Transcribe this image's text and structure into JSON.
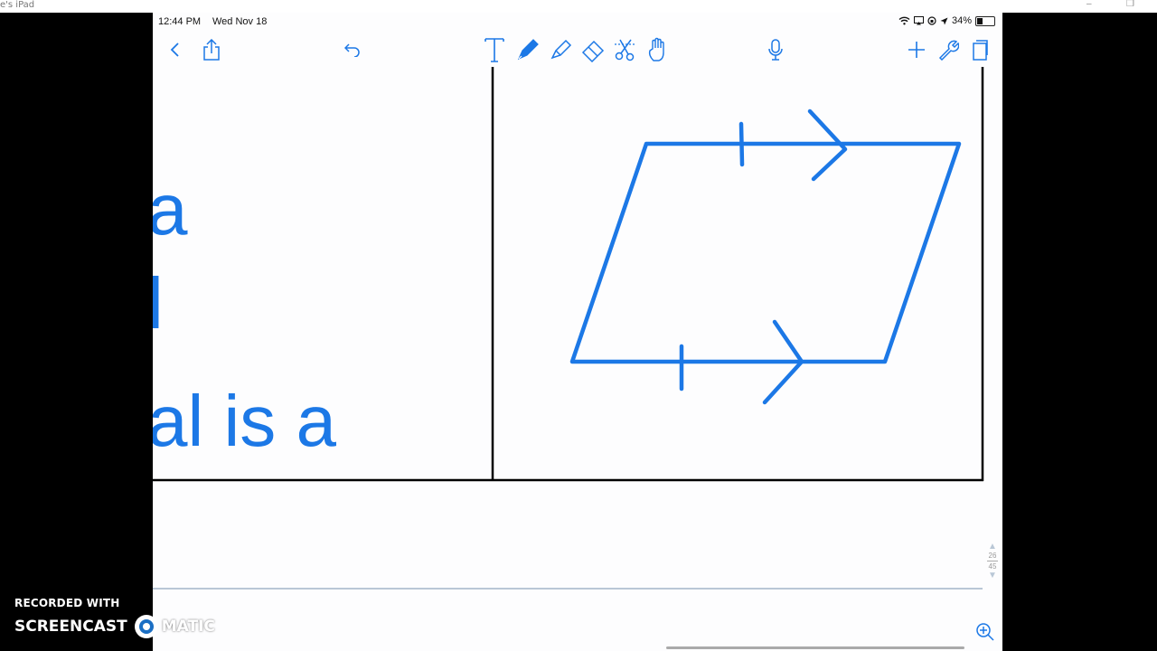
{
  "window": {
    "title": "e's iPad",
    "minimize_glyph": "–",
    "restore_glyph": "❐"
  },
  "status_bar": {
    "time": "12:44 PM",
    "date": "Wed Nov 18",
    "battery": "34%",
    "battery_level": 0.34,
    "icons": [
      "wifi-icon",
      "screen-mirroring-icon",
      "orientation-lock-icon",
      "location-icon"
    ]
  },
  "toolbar": {
    "left": [
      "back-icon",
      "share-icon",
      "undo-icon"
    ],
    "tools": [
      "text-tool-icon",
      "pen-tool-icon",
      "highlighter-tool-icon",
      "eraser-tool-icon",
      "lasso-tool-icon",
      "hand-tool-icon"
    ],
    "right": [
      "microphone-icon",
      "add-page-icon",
      "settings-wrench-icon",
      "pages-icon"
    ],
    "accent_color": "#1c78e6"
  },
  "page": {
    "text_lines": [
      "a",
      "l",
      "al is a"
    ],
    "text_color": "#1c78e6",
    "drawing": {
      "shape": "parallelogram",
      "stroke_color": "#1c78e6",
      "marks": [
        "tick-mark",
        "arrow-mark"
      ]
    },
    "page_indicator": {
      "current": "26",
      "total": "45"
    }
  },
  "watermark": {
    "line1": "RECORDED WITH",
    "line2a": "SCREENCAST",
    "line2b": "MATIC"
  }
}
